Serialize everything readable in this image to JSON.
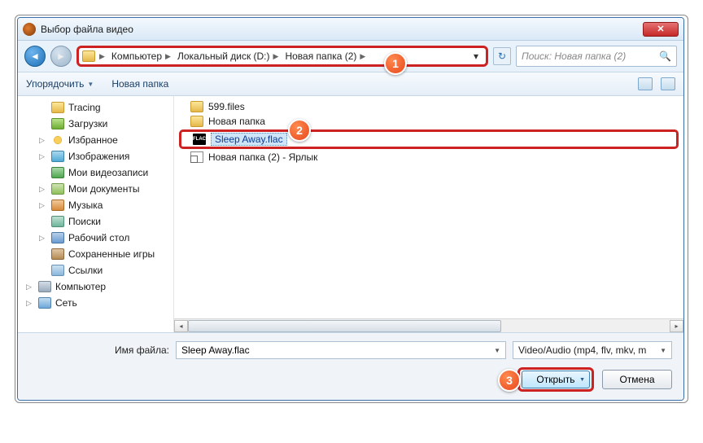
{
  "title": "Выбор файла видео",
  "breadcrumb": [
    "Компьютер",
    "Локальный диск (D:)",
    "Новая папка (2)"
  ],
  "search_placeholder": "Поиск: Новая папка (2)",
  "toolbar": {
    "organize": "Упорядочить",
    "newfolder": "Новая папка"
  },
  "tree": [
    {
      "label": "Tracing",
      "icon": "ic-folder",
      "lvl": 1
    },
    {
      "label": "Загрузки",
      "icon": "ic-dl",
      "lvl": 1
    },
    {
      "label": "Избранное",
      "icon": "ic-star",
      "lvl": 1,
      "exp": true
    },
    {
      "label": "Изображения",
      "icon": "ic-pic",
      "lvl": 1,
      "exp": true
    },
    {
      "label": "Мои видеозаписи",
      "icon": "ic-vid",
      "lvl": 1
    },
    {
      "label": "Мои документы",
      "icon": "ic-doc",
      "lvl": 1,
      "exp": true
    },
    {
      "label": "Музыка",
      "icon": "ic-music",
      "lvl": 1,
      "exp": true
    },
    {
      "label": "Поиски",
      "icon": "ic-search",
      "lvl": 1
    },
    {
      "label": "Рабочий стол",
      "icon": "ic-desk",
      "lvl": 1,
      "exp": true
    },
    {
      "label": "Сохраненные игры",
      "icon": "ic-save",
      "lvl": 1
    },
    {
      "label": "Ссылки",
      "icon": "ic-link",
      "lvl": 1
    },
    {
      "label": "Компьютер",
      "icon": "ic-pc",
      "lvl": 0,
      "exp": true
    },
    {
      "label": "Сеть",
      "icon": "ic-net",
      "lvl": 0,
      "exp": true
    }
  ],
  "files": [
    {
      "name": "599.files",
      "icon": "ic-folder"
    },
    {
      "name": "Новая папка",
      "icon": "ic-folder"
    },
    {
      "name": "Sleep Away.flac",
      "icon": "ic-flac",
      "selected": true
    },
    {
      "name": "Новая папка (2) - Ярлык",
      "icon": "ic-shortcut"
    }
  ],
  "footer": {
    "fn_label": "Имя файла:",
    "fn_value": "Sleep Away.flac",
    "type_value": "Video/Audio (mp4, flv, mkv, m",
    "open": "Открыть",
    "cancel": "Отмена"
  },
  "callouts": {
    "c1": "1",
    "c2": "2",
    "c3": "3"
  }
}
